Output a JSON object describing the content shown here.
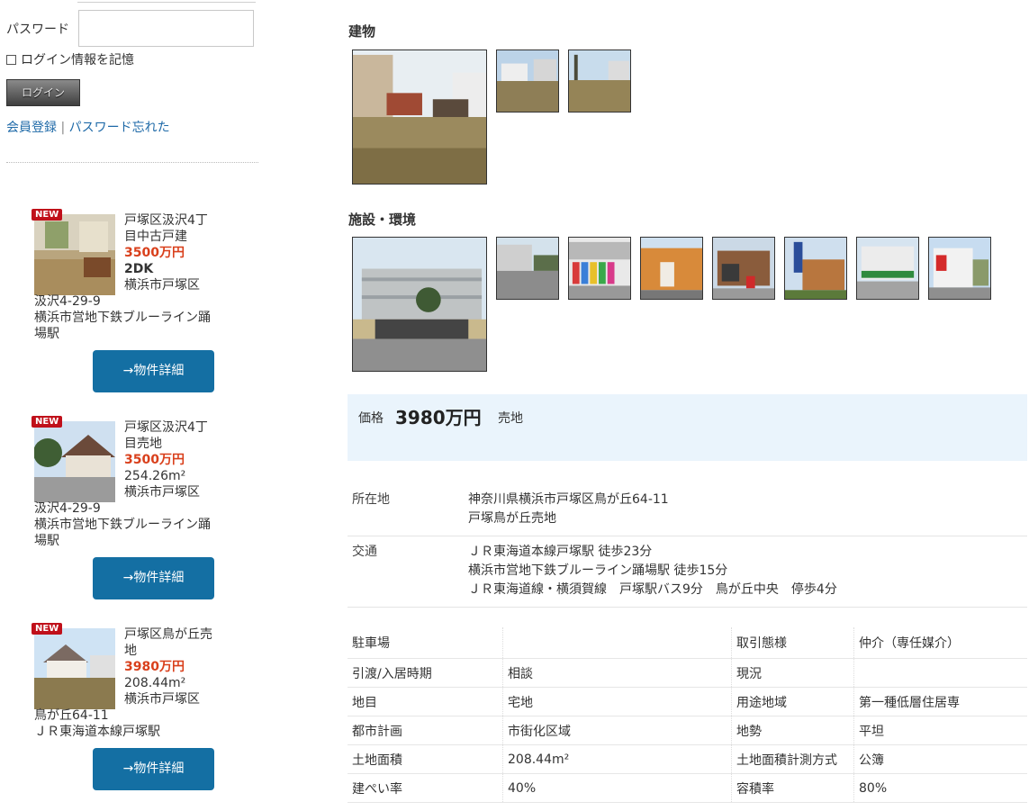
{
  "login": {
    "password_label": "パスワード",
    "remember_label": "ログイン情報を記憶",
    "login_button": "ログイン",
    "register_link": "会員登録",
    "separator": "|",
    "forgot_link": "パスワード忘れた"
  },
  "listings": [
    {
      "badge": "NEW",
      "title": "戸塚区汲沢4丁目中古戸建",
      "price": "3500万円",
      "spec": "2DK",
      "spec_bold": true,
      "address_line1": "横浜市戸塚区",
      "address_line2": "汲沢4-29-9",
      "station": "横浜市営地下鉄ブルーライン踊場駅",
      "button": "→物件詳細"
    },
    {
      "badge": "NEW",
      "title": "戸塚区汲沢4丁目売地",
      "price": "3500万円",
      "spec": "254.26m²",
      "spec_bold": false,
      "address_line1": "横浜市戸塚区",
      "address_line2": "汲沢4-29-9",
      "station": "横浜市営地下鉄ブルーライン踊場駅",
      "button": "→物件詳細"
    },
    {
      "badge": "NEW",
      "title": "戸塚区鳥が丘売地",
      "price": "3980万円",
      "spec": "208.44m²",
      "spec_bold": false,
      "address_line1": "横浜市戸塚区",
      "address_line2": "鳥が丘64-11",
      "station": "ＪＲ東海道本線戸塚駅",
      "button": "→物件詳細"
    }
  ],
  "sections": {
    "building_title": "建物",
    "facilities_title": "施設・環境"
  },
  "price": {
    "label": "価格",
    "value": "3980万円",
    "type": "売地"
  },
  "location": {
    "label": "所在地",
    "line1": "神奈川県横浜市戸塚区鳥が丘64-11",
    "line2": "戸塚鳥が丘売地"
  },
  "transport": {
    "label": "交通",
    "line1": "ＪＲ東海道本線戸塚駅 徒歩23分",
    "line2": "横浜市営地下鉄ブルーライン踊場駅 徒歩15分",
    "line3": "ＪＲ東海道線・横須賀線　戸塚駅バス9分　鳥が丘中央　停歩4分"
  },
  "spec_table": [
    [
      "駐車場",
      "",
      "取引態様",
      "仲介（専任媒介）"
    ],
    [
      "引渡/入居時期",
      "相談",
      "現況",
      ""
    ],
    [
      "地目",
      "宅地",
      "用途地域",
      "第一種低層住居専"
    ],
    [
      "都市計画",
      "市街化区域",
      "地勢",
      "平坦"
    ],
    [
      "土地面積",
      "208.44m²",
      "土地面積計測方式",
      "公簿"
    ],
    [
      "建ぺい率",
      "40%",
      "容積率",
      "80%"
    ]
  ],
  "colors": {
    "accent_blue": "#146fa3",
    "price_red": "#d9401c",
    "new_badge": "#c0101a",
    "link": "#1f6aa8",
    "price_box_bg": "#eaf4fc"
  }
}
